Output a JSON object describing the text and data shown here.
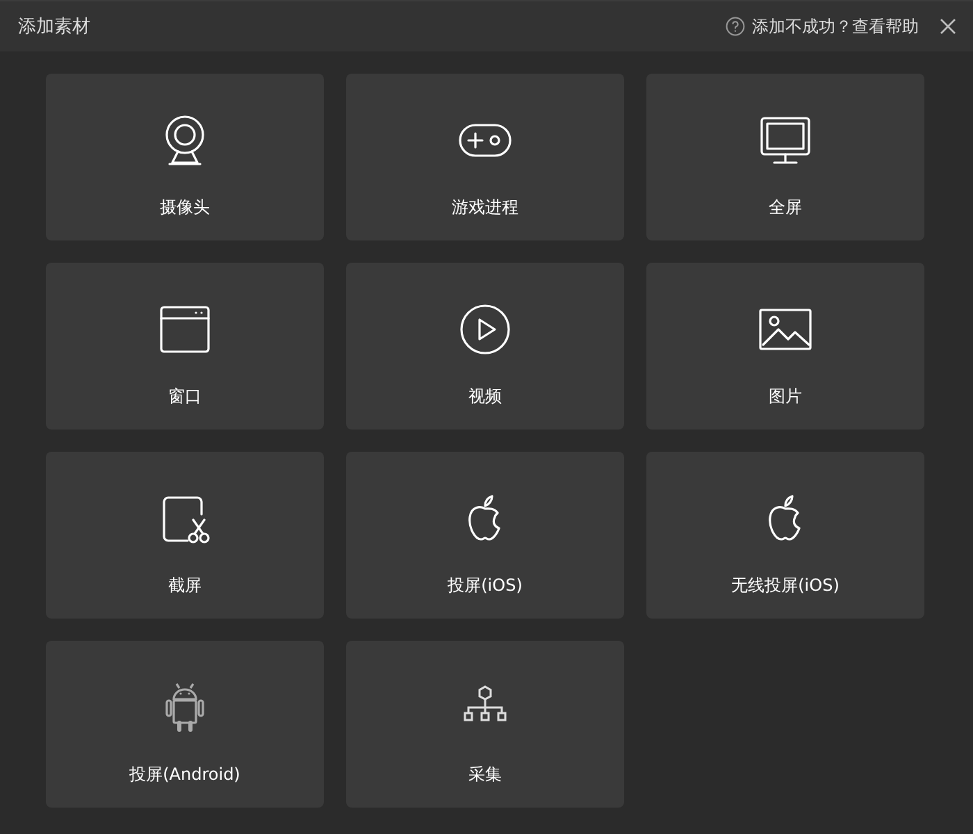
{
  "window": {
    "title": "添加素材",
    "help_link": "添加不成功？查看帮助"
  },
  "tiles": [
    {
      "label": "摄像头",
      "kind": "camera"
    },
    {
      "label": "游戏进程",
      "kind": "gamepad"
    },
    {
      "label": "全屏",
      "kind": "monitor"
    },
    {
      "label": "窗口",
      "kind": "window"
    },
    {
      "label": "视频",
      "kind": "play"
    },
    {
      "label": "图片",
      "kind": "image"
    },
    {
      "label": "截屏",
      "kind": "screenshot"
    },
    {
      "label": "投屏(iOS)",
      "kind": "apple"
    },
    {
      "label": "无线投屏(iOS)",
      "kind": "apple"
    },
    {
      "label": "投屏(Android)",
      "kind": "robot"
    },
    {
      "label": "采集",
      "kind": "hierarchy"
    }
  ]
}
